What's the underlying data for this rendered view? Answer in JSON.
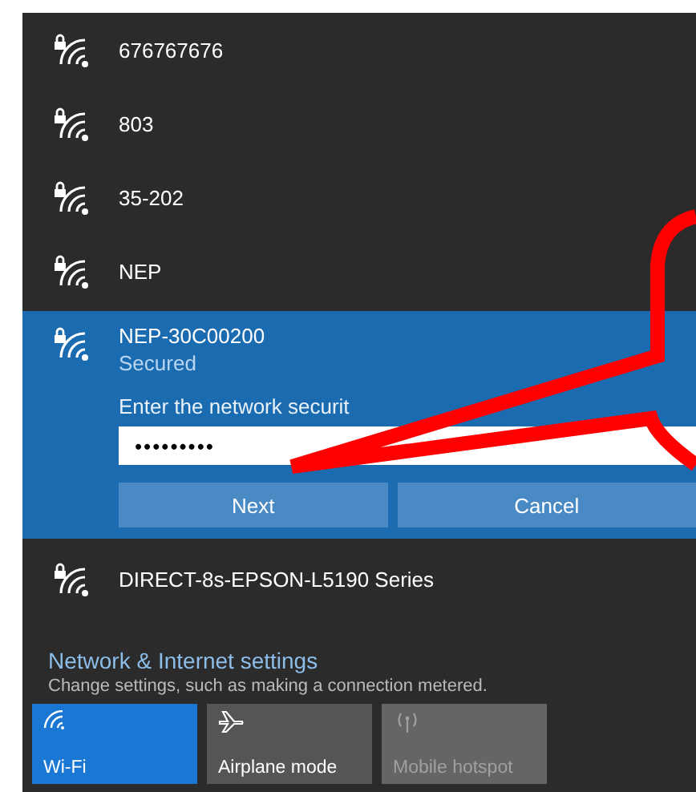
{
  "networks": [
    {
      "name": "676767676",
      "secured": true,
      "selected": false
    },
    {
      "name": "803",
      "secured": true,
      "selected": false
    },
    {
      "name": "35-202",
      "secured": true,
      "selected": false
    },
    {
      "name": "NEP",
      "secured": true,
      "selected": false
    },
    {
      "name": "NEP-30C00200",
      "secured": true,
      "selected": true,
      "status": "Secured",
      "prompt": "Enter the network securit",
      "password": "•••••••••",
      "buttons": [
        "Next",
        "Cancel"
      ]
    },
    {
      "name": "DIRECT-8s-EPSON-L5190 Series",
      "secured": true,
      "selected": false
    }
  ],
  "settings": {
    "title": "Network & Internet settings",
    "description": "Change settings, such as making a connection metered."
  },
  "quick_actions": [
    {
      "kind": "wifi",
      "label": "Wi-Fi",
      "on": true,
      "disabled": false
    },
    {
      "kind": "airplane",
      "label": "Airplane mode",
      "on": false,
      "disabled": false
    },
    {
      "kind": "hotspot",
      "label": "Mobile hotspot",
      "on": false,
      "disabled": true
    }
  ],
  "annotation": {
    "kind": "callout-arrow"
  }
}
